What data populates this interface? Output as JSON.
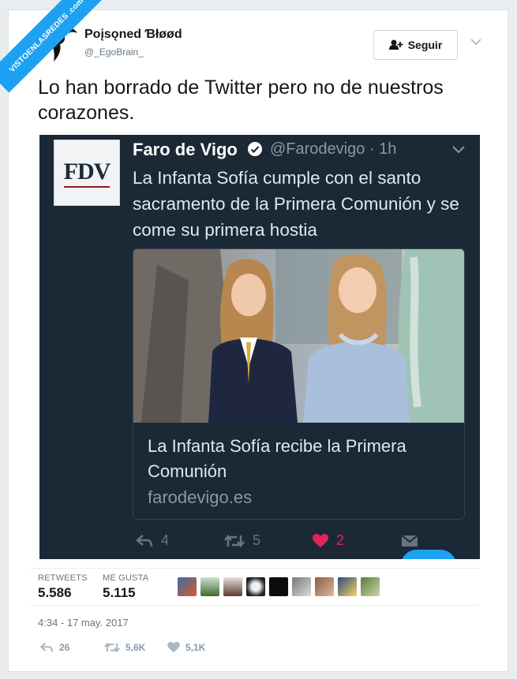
{
  "watermark": {
    "text": "VISTOENLASREDES .com"
  },
  "author": {
    "name": "Poisoned Blood",
    "display_name": "Poįsǫned Ɓłøød",
    "handle": "@_EgoBrain_",
    "avatar_icon": "avatar-profile-image"
  },
  "follow_button": {
    "label": "Seguir",
    "icon": "add-user-icon"
  },
  "tweet": {
    "text": "Lo han borrado de Twitter pero no de nuestros corazones."
  },
  "embedded_tweet": {
    "logo_text": "FDV",
    "author_name": "Faro de Vigo",
    "meta": "@Farodevigo · 1h",
    "text": "La Infanta Sofía cumple con el santo sacramento de la Primera Comunión y se come su primera hostia",
    "link_card": {
      "title": "La Infanta Sofía recibe la Primera Comunión",
      "domain": "farodevigo.es"
    },
    "actions": {
      "reply_count": "4",
      "retweet_count": "5",
      "like_count": "2"
    },
    "colors": {
      "background": "#1b2836",
      "like": "#e0245e"
    }
  },
  "stats": {
    "retweets_label": "RETWEETS",
    "retweets_value": "5.586",
    "likes_label": "ME GUSTA",
    "likes_value": "5.115"
  },
  "timestamp": "4:34 - 17 may. 2017",
  "footer_actions": {
    "reply_count": "26",
    "retweet_count": "5,6K",
    "like_count": "5,1K"
  }
}
